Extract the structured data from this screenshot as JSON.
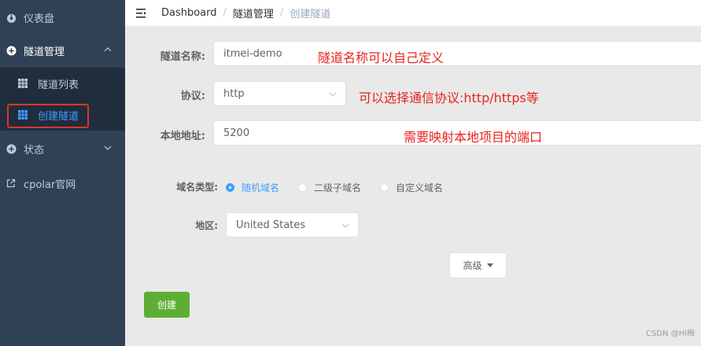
{
  "sidebar": {
    "items": [
      {
        "label": "仪表盘",
        "icon": "dashboard-icon"
      },
      {
        "label": "隧道管理",
        "icon": "plus-circle-icon"
      },
      {
        "label": "状态",
        "icon": "plus-circle-icon"
      },
      {
        "label": "cpolar官网",
        "icon": "external-link-icon"
      }
    ],
    "submenu": [
      {
        "label": "隧道列表",
        "icon": "grid-icon"
      },
      {
        "label": "创建隧道",
        "icon": "grid-icon"
      }
    ],
    "colors": {
      "bg": "#304156",
      "submenu_bg": "#1f2d3d",
      "active": "#409eff",
      "highlight": "#e0332a"
    }
  },
  "header": {
    "breadcrumb": [
      "Dashboard",
      "隧道管理",
      "创建隧道"
    ],
    "separator": "/"
  },
  "form": {
    "name_label": "隧道名称:",
    "name_value": "itmei-demo",
    "protocol_label": "协议:",
    "protocol_value": "http",
    "local_label": "本地地址:",
    "local_value": "5200",
    "domain_type_label": "域名类型:",
    "domain_options": [
      "随机域名",
      "二级子域名",
      "自定义域名"
    ],
    "domain_selected": "随机域名",
    "region_label": "地区:",
    "region_value": "United States",
    "advanced_label": "高级",
    "create_label": "创建"
  },
  "annotations": {
    "name_note": "隧道名称可以自己定义",
    "protocol_note": "可以选择通信协议:http/https等",
    "local_note": "需要映射本地项目的端口",
    "color": "#e8231e"
  },
  "watermark": "CSDN @Hi梅"
}
